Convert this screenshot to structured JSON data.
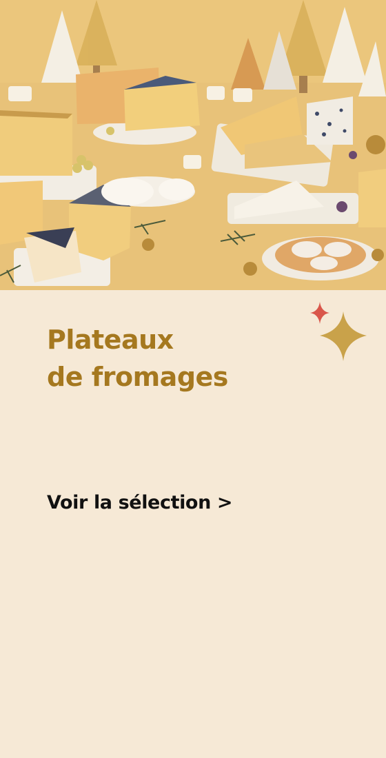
{
  "promo": {
    "title_line1": "Plateaux",
    "title_line2": "de fromages",
    "cta_label": "Voir la sélection >",
    "image_alt": "cheese-platters-holiday-photo",
    "colors": {
      "background": "#f6e9d6",
      "title": "#a5781f",
      "cta": "#111111",
      "sparkle_red": "#d9564a",
      "sparkle_gold": "#c9a24a"
    }
  }
}
